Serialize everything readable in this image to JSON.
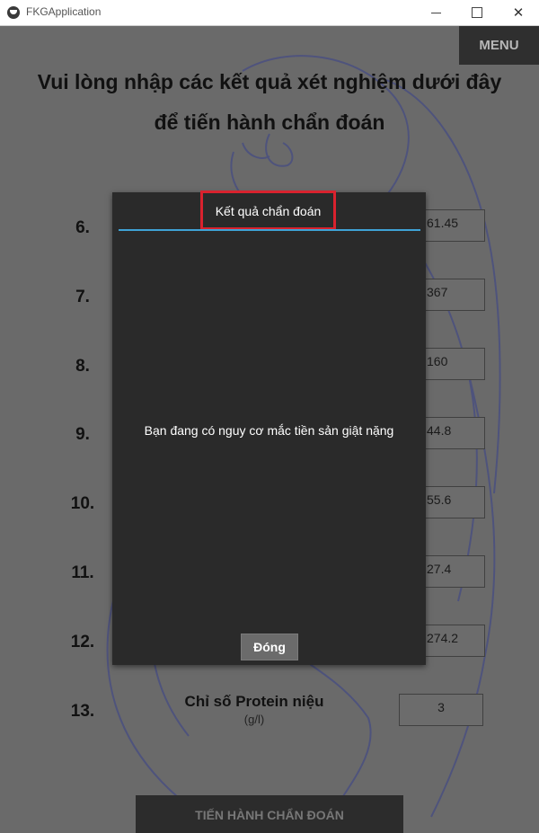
{
  "window": {
    "title": "FKGApplication",
    "icon": "app-logo-icon"
  },
  "menu": {
    "label": "MENU"
  },
  "heading": {
    "line1": "Vui lòng nhập các kết quả xét nghiệm dưới đây",
    "line2": "để tiến hành chẩn đoán"
  },
  "rows": [
    {
      "number": "6.",
      "value": "61.45"
    },
    {
      "number": "7.",
      "value": "367"
    },
    {
      "number": "8.",
      "value": "160"
    },
    {
      "number": "9.",
      "value": "44.8"
    },
    {
      "number": "10.",
      "value": "55.6"
    },
    {
      "number": "11.",
      "value": "27.4"
    },
    {
      "number": "12.",
      "value": "274.2"
    },
    {
      "number": "13.",
      "value": "3",
      "label": "Chỉ số Protein niệu",
      "unit": "(g/l)"
    }
  ],
  "submit_button": {
    "label": "TIẾN HÀNH CHẨN ĐOÁN"
  },
  "dialog": {
    "title": "Kết quả chẩn đoán",
    "message": "Bạn đang có nguy cơ mắc tiền sản giật nặng",
    "close_label": "Đóng",
    "highlight_color": "#d9222e",
    "separator_color": "#3fa3d6"
  }
}
